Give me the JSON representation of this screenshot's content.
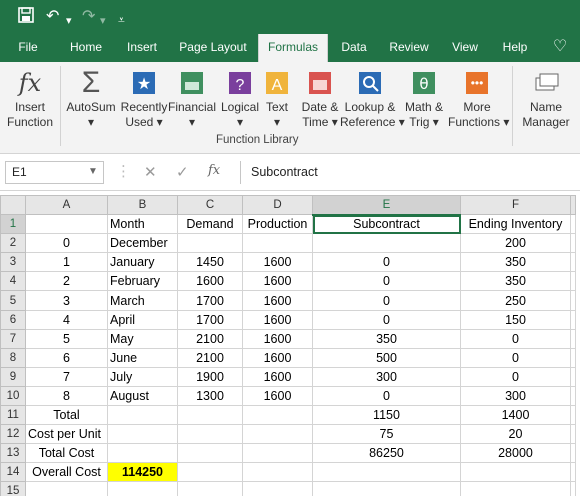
{
  "quick_access": {
    "save_icon": "save-icon",
    "undo_icon": "undo-icon",
    "redo_icon": "redo-icon",
    "customize_icon": "customize-icon"
  },
  "tabs": [
    "File",
    "Home",
    "Insert",
    "Page Layout",
    "Formulas",
    "Data",
    "Review",
    "View",
    "Help"
  ],
  "active_tab": "Formulas",
  "ribbon": {
    "buttons": [
      {
        "l1": "Insert",
        "l2": "Function"
      },
      {
        "l1": "AutoSum",
        "l2": "▾"
      },
      {
        "l1": "Recently",
        "l2": "Used ▾"
      },
      {
        "l1": "Financial",
        "l2": "▾"
      },
      {
        "l1": "Logical",
        "l2": "▾"
      },
      {
        "l1": "Text",
        "l2": "▾"
      },
      {
        "l1": "Date &",
        "l2": "Time ▾"
      },
      {
        "l1": "Lookup &",
        "l2": "Reference ▾"
      },
      {
        "l1": "Math &",
        "l2": "Trig ▾"
      },
      {
        "l1": "More",
        "l2": "Functions ▾"
      },
      {
        "l1": "Name",
        "l2": "Manager"
      }
    ],
    "group_label": "Function Library"
  },
  "formula_bar": {
    "name_box": "E1",
    "formula": "Subcontract"
  },
  "colors": {
    "accent": "#217346",
    "highlight": "#ffff00"
  },
  "columns": [
    "A",
    "B",
    "C",
    "D",
    "E",
    "F"
  ],
  "rows": [
    {
      "n": "1",
      "cells": [
        "",
        "Month",
        "Demand",
        "Production",
        "Subcontract",
        "Ending Inventory"
      ]
    },
    {
      "n": "2",
      "cells": [
        "0",
        "December",
        "",
        "",
        "",
        "200"
      ]
    },
    {
      "n": "3",
      "cells": [
        "1",
        "January",
        "1450",
        "1600",
        "0",
        "350"
      ]
    },
    {
      "n": "4",
      "cells": [
        "2",
        "February",
        "1600",
        "1600",
        "0",
        "350"
      ]
    },
    {
      "n": "5",
      "cells": [
        "3",
        "March",
        "1700",
        "1600",
        "0",
        "250"
      ]
    },
    {
      "n": "6",
      "cells": [
        "4",
        "April",
        "1700",
        "1600",
        "0",
        "150"
      ]
    },
    {
      "n": "7",
      "cells": [
        "5",
        "May",
        "2100",
        "1600",
        "350",
        "0"
      ]
    },
    {
      "n": "8",
      "cells": [
        "6",
        "June",
        "2100",
        "1600",
        "500",
        "0"
      ]
    },
    {
      "n": "9",
      "cells": [
        "7",
        "July",
        "1900",
        "1600",
        "300",
        "0"
      ]
    },
    {
      "n": "10",
      "cells": [
        "8",
        "August",
        "1300",
        "1600",
        "0",
        "300"
      ]
    },
    {
      "n": "11",
      "cells": [
        "Total",
        "",
        "",
        "",
        "1150",
        "1400"
      ]
    },
    {
      "n": "12",
      "cells": [
        "Cost per Unit",
        "",
        "",
        "",
        "75",
        "20"
      ]
    },
    {
      "n": "13",
      "cells": [
        "Total Cost",
        "",
        "",
        "",
        "86250",
        "28000"
      ]
    },
    {
      "n": "14",
      "cells": [
        "Overall Cost",
        "114250",
        "",
        "",
        "",
        ""
      ]
    },
    {
      "n": "15",
      "cells": [
        "",
        "",
        "",
        "",
        "",
        ""
      ]
    }
  ]
}
